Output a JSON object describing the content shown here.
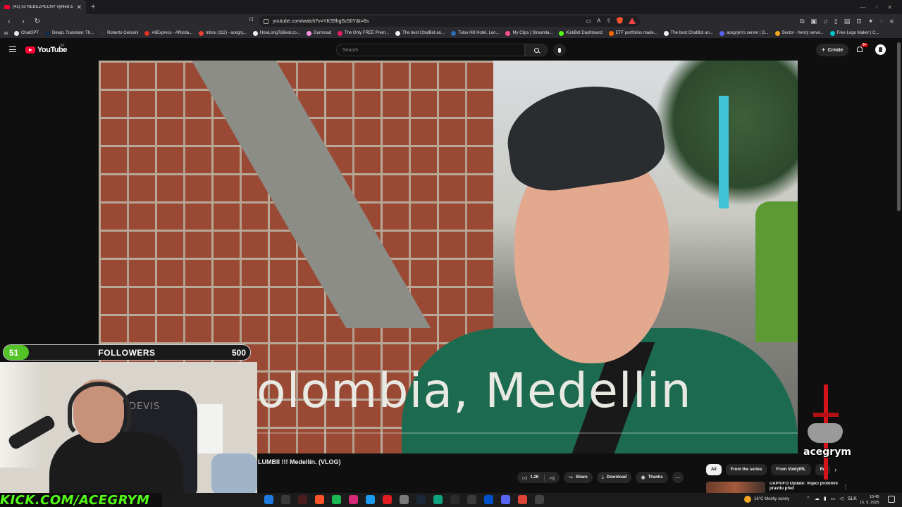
{
  "browser": {
    "tab_title": "(41) co NEBEZPEČNÝ výhled za",
    "tab_close": "✕",
    "new_tab": "+",
    "url": "youtube.com/watch?v=YKS9hgSc50Y&t=6s",
    "bookmarks": [
      {
        "label": "ChatGPT",
        "color": "#e8e8e8"
      },
      {
        "label": "DeepL Translate: Th...",
        "color": "#0f2b46"
      },
      {
        "label": "Roberto Geissini",
        "color": "#333333"
      },
      {
        "label": "AliExpress - Afforda...",
        "color": "#e43225"
      },
      {
        "label": "Inbox (112) - acegry...",
        "color": "#ea4335"
      },
      {
        "label": "HowLongToBeat.co...",
        "color": "#f1f1f1"
      },
      {
        "label": "Gumroad",
        "color": "#ff90e8"
      },
      {
        "label": "The Only FREE Prem...",
        "color": "#e91e63"
      },
      {
        "label": "The best ChatBot an...",
        "color": "#f1f1f1"
      },
      {
        "label": "Tulse Hill Hotel, Lon...",
        "color": "#2b6cb0"
      },
      {
        "label": "My Clips | Streamla...",
        "color": "#ff4f8b"
      },
      {
        "label": "KickBot Dashboard",
        "color": "#53fc18"
      },
      {
        "label": "ETF portfolios made...",
        "color": "#ff6a00"
      },
      {
        "label": "The best ChatBot an...",
        "color": "#f1f1f1"
      },
      {
        "label": "acegrym's server | D...",
        "color": "#5865f2"
      },
      {
        "label": "Sector - herný serve...",
        "color": "#f5a623"
      },
      {
        "label": "Free Logo Maker | C...",
        "color": "#00c4cc"
      }
    ]
  },
  "youtube": {
    "logo_word": "YouTube",
    "region": "SK",
    "search_placeholder": "Search",
    "create_label": "Create",
    "notifications_badge": "9+",
    "overlay_text": "olombia, Medellin",
    "video_title": "LUMBII !!! Medellín. (VLOG)",
    "actions": {
      "likes": "1.2K",
      "share": "Share",
      "download": "Download",
      "thanks": "Thanks",
      "more": "···"
    },
    "chips": [
      "All",
      "From the series",
      "From VoldyIRL",
      "Re"
    ],
    "chip_next": "›",
    "recommended": {
      "title": "UAP/UFO Update: Vojáci prolomili pravdu před",
      "more": "⋮"
    }
  },
  "stream": {
    "followers_count": "51",
    "followers_label": "FOLLOWERS",
    "followers_goal": "500",
    "followers_progress": 0.102,
    "chair_brand": "DEVIS",
    "kick_url": "KICK.COM/ACEGRYM",
    "streamer_name": "acegrym"
  },
  "taskbar": {
    "weather": "16°C  Mostly sunny",
    "language": "SLK",
    "time": "10:45",
    "date": "15. 9. 2025",
    "apps": [
      {
        "name": "edge",
        "color": "#1f7ae0"
      },
      {
        "name": "calculator",
        "color": "#3a3a3a"
      },
      {
        "name": "terminal",
        "color": "#4a1e1e"
      },
      {
        "name": "brave",
        "color": "#fb542b"
      },
      {
        "name": "spotify",
        "color": "#1db954"
      },
      {
        "name": "instagram",
        "color": "#d62976"
      },
      {
        "name": "twitter",
        "color": "#1d9bf0"
      },
      {
        "name": "opera",
        "color": "#e11b22"
      },
      {
        "name": "files",
        "color": "#7a7a7a"
      },
      {
        "name": "steam",
        "color": "#1b2838"
      },
      {
        "name": "chatgpt",
        "color": "#10a37f"
      },
      {
        "name": "capcut",
        "color": "#2b2b2b"
      },
      {
        "name": "notion",
        "color": "#3b3b3b"
      },
      {
        "name": "trello",
        "color": "#0052cc"
      },
      {
        "name": "discord",
        "color": "#5865f2"
      },
      {
        "name": "chrome",
        "color": "#db4437"
      },
      {
        "name": "app",
        "color": "#444444"
      }
    ]
  }
}
